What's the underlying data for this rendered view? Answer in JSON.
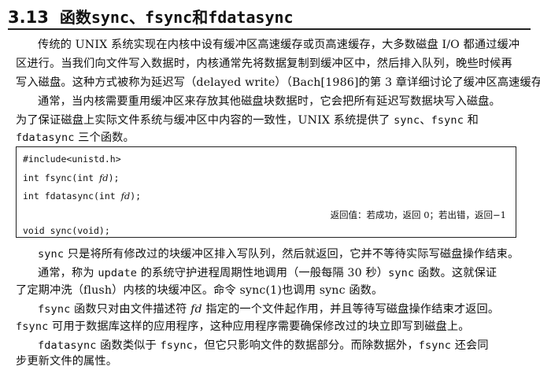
{
  "section": {
    "number": "3.13",
    "title_prefix": "函数 ",
    "f1": "sync",
    "sep1": "、",
    "f2": "fsync",
    "sep2": " 和 ",
    "f3": "fdatasync"
  },
  "para1": {
    "l1": "传统的 UNIX 系统实现在内核中设有缓冲区高速缓存或页高速缓存，大多数磁盘 I/O 都通过缓冲",
    "l2": "区进行。当我们向文件写入数据时，内核通常先将数据复制到缓冲区中，然后排入队列，晚些时候再",
    "l3": "写入磁盘。这种方式被称为延迟写（delayed write）（Bach[1986]的第 3 章详细讨论了缓冲区高速缓存）。"
  },
  "para2": {
    "l1": "通常，当内核需要重用缓冲区来存放其他磁盘块数据时，它会把所有延迟写数据块写入磁盘。",
    "l2a": "为了保证磁盘上实际文件系统与缓冲区中内容的一致性，UNIX 系统提供了 ",
    "l2b": "sync",
    "l2c": "、",
    "l2d": "fsync",
    "l2e": " 和",
    "l3a": "fdatasync",
    "l3b": " 三个函数。"
  },
  "codebox": {
    "include": "#include<unistd.h>",
    "fsync_a": "int fsync(int ",
    "fsync_b": "fd",
    "fsync_c": ");",
    "fdata_a": "int fdatasync(int ",
    "fdata_b": "fd",
    "fdata_c": ");",
    "returns": "返回值：若成功，返回 0；若出错，返回−1",
    "sync": "void sync(void);"
  },
  "para3": {
    "l1a": "sync",
    "l1b": " 只是将所有修改过的块缓冲区排入写队列，然后就返回，它并不等待实际写磁盘操作结束。"
  },
  "para4": {
    "l1a": "通常，称为 ",
    "l1b": "update",
    "l1c": " 的系统守护进程周期性地调用（一般每隔 30 秒）",
    "l1d": "sync",
    "l1e": " 函数。这就保证",
    "l2": "了定期冲洗（flush）内核的块缓冲区。命令 sync(1)也调用 sync 函数。"
  },
  "para5": {
    "l1a": "fsync",
    "l1b": " 函数只对由文件描述符 ",
    "l1c": "fd",
    "l1d": " 指定的一个文件起作用，并且等待写磁盘操作结束才返回。",
    "l2a": "fsync",
    "l2b": " 可用于数据库这样的应用程序，这种应用程序需要确保修改过的块立即写到磁盘上。"
  },
  "para6": {
    "l1a": "fdatasync",
    "l1b": " 函数类似于 ",
    "l1c": "fsync",
    "l1d": "，但它只影响文件的数据部分。而除数据外，",
    "l1e": "fsync",
    "l1f": " 还会同",
    "l2": "步更新文件的属性。"
  }
}
